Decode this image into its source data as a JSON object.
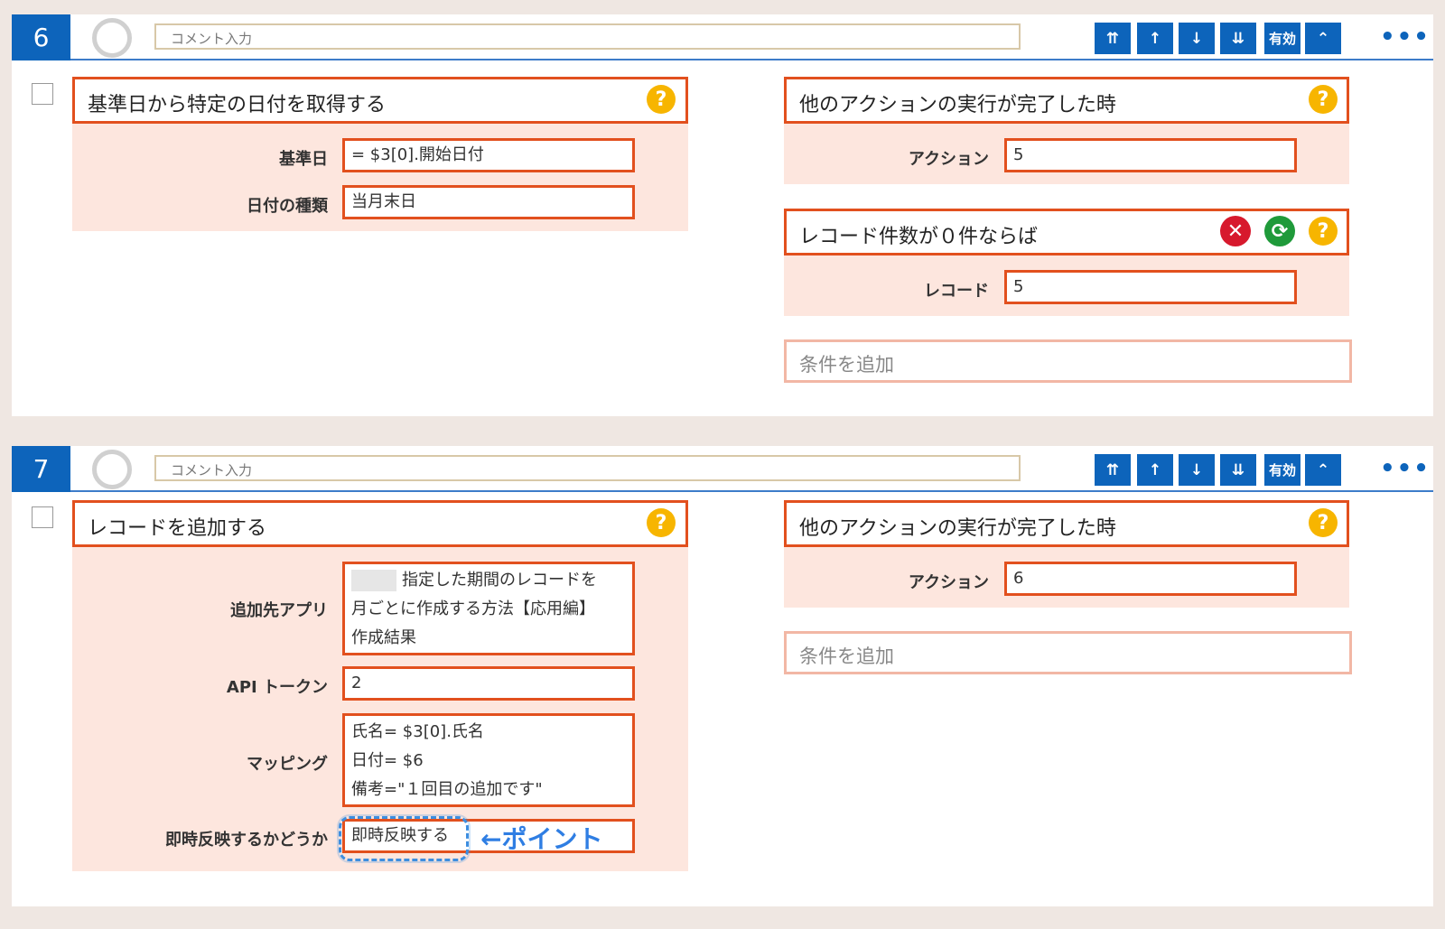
{
  "blocks": [
    {
      "number": "6",
      "comment_placeholder": "コメント入力",
      "toolbar": {
        "move_top": "⇈",
        "move_up": "↑",
        "move_down": "↓",
        "move_bottom": "⇊",
        "enabled_label": "有効",
        "collapse": "⌃",
        "more": "•••"
      },
      "action": {
        "title": "基準日から特定の日付を取得する",
        "fields": [
          {
            "label": "基準日",
            "value": "= $3[0].開始日付"
          },
          {
            "label": "日付の種類",
            "value": "当月末日"
          }
        ]
      },
      "conditions": [
        {
          "title": "他のアクションの実行が完了した時",
          "field_label": "アクション",
          "field_value": "5"
        },
        {
          "title": "レコード件数が０件ならば",
          "field_label": "レコード",
          "field_value": "5"
        }
      ],
      "add_condition": "条件を追加"
    },
    {
      "number": "7",
      "comment_placeholder": "コメント入力",
      "toolbar": {
        "move_top": "⇈",
        "move_up": "↑",
        "move_down": "↓",
        "move_bottom": "⇊",
        "enabled_label": "有効",
        "collapse": "⌃",
        "more": "•••"
      },
      "action": {
        "title": "レコードを追加する",
        "target_app_label": "追加先アプリ",
        "target_app_lines": [
          "指定した期間のレコードを",
          "月ごとに作成する方法【応用編】",
          "作成結果"
        ],
        "token_label": "API トークン",
        "token_value": "2",
        "mapping_label": "マッピング",
        "mapping_lines": [
          "氏名= $3[0].氏名",
          "日付= $6",
          "備考=\"１回目の追加です\""
        ],
        "immediate_label": "即時反映するかどうか",
        "immediate_value": "即時反映する",
        "annotation": "←ポイント"
      },
      "conditions": [
        {
          "title": "他のアクションの実行が完了した時",
          "field_label": "アクション",
          "field_value": "6"
        }
      ],
      "add_condition": "条件を追加"
    }
  ],
  "colors": {
    "accent_blue": "#0d64bb",
    "orange_border": "#e2501e",
    "panel_pink": "#fde6de",
    "help_yellow": "#f7b500",
    "delete_red": "#d7192d",
    "toggle_green": "#1f9a3a",
    "annotation_blue": "#2f7ee3"
  },
  "icons": {
    "help": "question-icon",
    "delete": "x-circle-icon",
    "toggle": "refresh-icon",
    "loading": "spinner-icon"
  }
}
